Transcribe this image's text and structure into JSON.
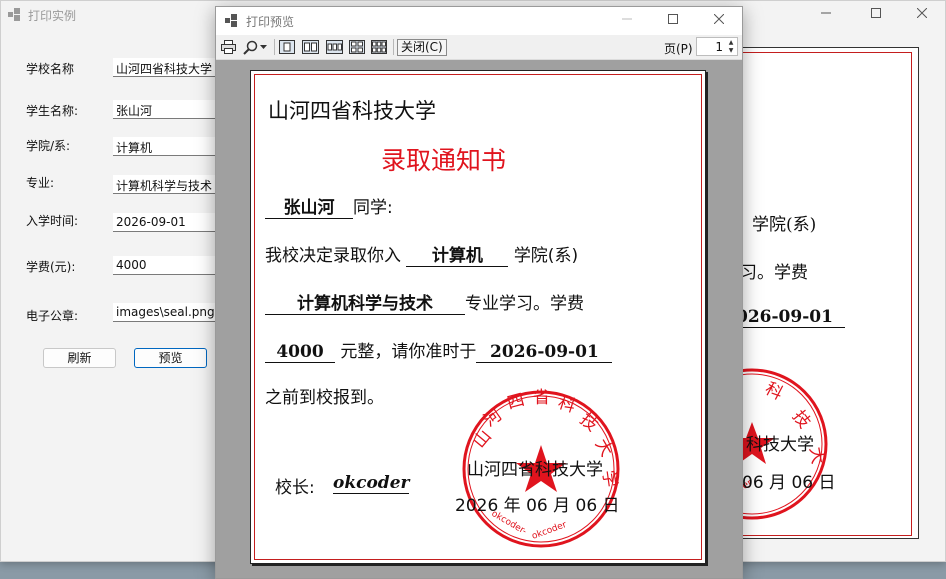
{
  "main_window": {
    "title": "打印实例",
    "fields": [
      {
        "label": "学校名称",
        "value": "山河四省科技大学"
      },
      {
        "label": "学生名称:",
        "value": "张山河"
      },
      {
        "label": "学院/系:",
        "value": "计算机"
      },
      {
        "label": "专业:",
        "value": "计算机科学与技术"
      },
      {
        "label": "入学时间:",
        "value": "2026-09-01"
      },
      {
        "label": "学费(元):",
        "value": "4000"
      },
      {
        "label": "电子公章:",
        "value": "images\\seal.png"
      }
    ],
    "buttons": {
      "refresh": "刷新",
      "preview": "预览"
    }
  },
  "preview_window": {
    "title": "打印预览",
    "toolbar": {
      "close_label": "关闭(C)",
      "page_label": "页(P)",
      "page_value": "1"
    }
  },
  "certificate": {
    "school": "山河四省科技大学",
    "heading": "录取通知书",
    "student": "张山河",
    "greeting": "同学:",
    "line2_prefix": "我校决定录取你入",
    "college": "计算机",
    "line2_suffix": "学院(系)",
    "major": "计算机科学与技术",
    "line3_suffix": "专业学习。学费",
    "fee": "4000",
    "line4_mid": "元整，请你准时于",
    "date": "2026-09-01",
    "line5": "之前到校报到。",
    "principal_label": "校长:",
    "principal_signature": "okcoder",
    "sign_school": "山河四省科技大学",
    "sign_date": "2026 年 06 月 06 日",
    "seal": {
      "top_text": "山河四省科技大学",
      "bottom_text": "okcoder-okcoder",
      "color": "#e0141e"
    }
  },
  "background_copy": {
    "line2_suffix": "学院(系)",
    "line3_tail": "习。学费",
    "date": "026-09-01",
    "sign_school": "科技大学",
    "sign_date": "06 月 06 日"
  },
  "colors": {
    "seal_red": "#e0141e",
    "frame_red": "#c41e1e",
    "accent": "#0067c0"
  }
}
